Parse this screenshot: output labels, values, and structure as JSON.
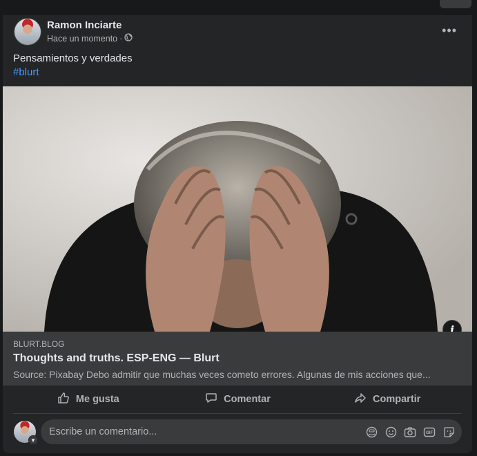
{
  "post": {
    "author": "Ramon Inciarte",
    "time": "Hace un momento",
    "separator": "·",
    "text": "Pensamientos y verdades",
    "hashtag": "#blurt"
  },
  "link_preview": {
    "domain": "BLURT.BLOG",
    "title": "Thoughts and truths. ESP-ENG — Blurt",
    "description": "Source: Pixabay Debo admitir que muchas veces cometo errores. Algunas de mis acciones que..."
  },
  "actions": {
    "like": "Me gusta",
    "comment": "Comentar",
    "share": "Compartir"
  },
  "comment": {
    "placeholder": "Escribe un comentario..."
  },
  "icons": [
    "globe-icon",
    "more-icon",
    "info-icon",
    "like-icon",
    "comment-icon",
    "share-icon",
    "chevron-down-icon",
    "avatar-sticker-icon",
    "emoji-icon",
    "camera-icon",
    "gif-icon",
    "sticker-icon"
  ],
  "colors": {
    "hashtag": "#4599ff",
    "card": "#242526",
    "background": "#18191a"
  }
}
